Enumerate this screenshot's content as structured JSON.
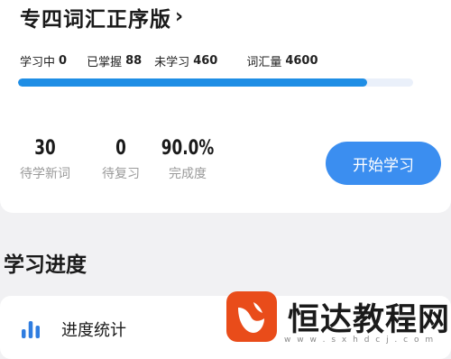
{
  "header": {
    "title": "专四词汇正序版",
    "chevron": "›"
  },
  "stats": [
    {
      "label": "学习中",
      "value": "0"
    },
    {
      "label": "已掌握",
      "value": "88"
    },
    {
      "label": "未学习",
      "value": "460"
    },
    {
      "label": "词汇量",
      "value": "4600"
    }
  ],
  "progress": {
    "fraction": 0.884
  },
  "metrics": [
    {
      "value": "30",
      "caption": "待学新词"
    },
    {
      "value": "0",
      "caption": "待复习"
    },
    {
      "value": "90.0%",
      "caption": "完成度"
    }
  ],
  "start_button": "开始学习",
  "section": {
    "title": "学习进度"
  },
  "progress_stats": {
    "label": "进度统计",
    "icon": "bar-chart-icon"
  },
  "watermark": {
    "text": "恒达教程网",
    "url": "w w w . s x h d c j . c o m",
    "logo_color": "#e94c1a"
  },
  "colors": {
    "accent": "#3b8ef0",
    "progress": "#1f8ee5"
  }
}
